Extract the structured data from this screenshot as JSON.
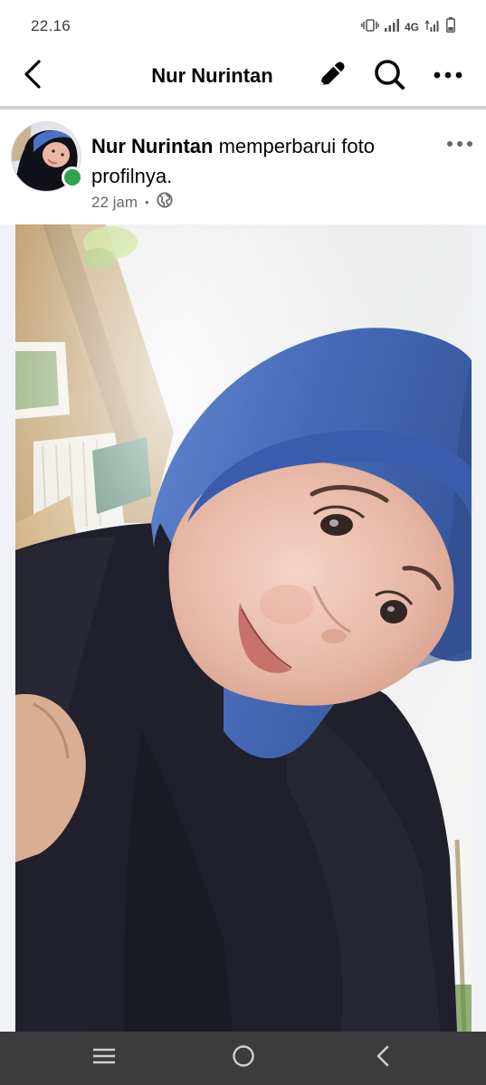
{
  "status_bar": {
    "time": "22.16",
    "network_label": "4G",
    "icons": [
      "vibrate-icon",
      "signal-icon",
      "mobile-data-icon",
      "battery-icon"
    ]
  },
  "header": {
    "title": "Nur Nurintan",
    "icons": [
      "back-arrow-icon",
      "pencil-icon",
      "search-icon",
      "more-horizontal-icon"
    ]
  },
  "post": {
    "author": "Nur Nurintan",
    "action_text": " memperbarui foto profilnya.",
    "time": "22 jam",
    "separator": "•",
    "privacy_icon": "globe-icon",
    "online": true,
    "photo_description_icon": "profile-photo"
  },
  "nav_bar": {
    "icons": [
      "recent-apps-icon",
      "home-icon",
      "back-icon"
    ]
  },
  "colors": {
    "online_green": "#31a24c",
    "meta_gray": "#65676b",
    "nav_bar_bg": "#3c3c3c",
    "divider": "#cfd3d8",
    "hijab_blue": "#3d63b5"
  }
}
